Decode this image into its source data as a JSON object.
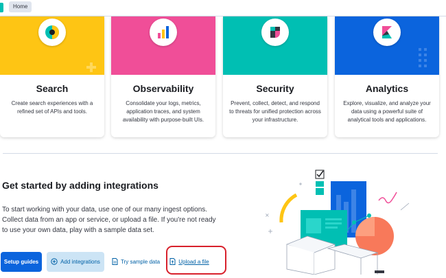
{
  "breadcrumb": {
    "home": "Home"
  },
  "cards": [
    {
      "id": "search",
      "title": "Search",
      "description": "Create search experiences with a refined set of APIs and tools.",
      "color": "#fec514",
      "icon": "search-icon"
    },
    {
      "id": "observability",
      "title": "Observability",
      "description": "Consolidate your logs, metrics, application traces, and system availability with purpose-built UIs.",
      "color": "#f04e98",
      "icon": "observability-icon"
    },
    {
      "id": "security",
      "title": "Security",
      "description": "Prevent, collect, detect, and respond to threats for unified protection across your infrastructure.",
      "color": "#00bfb3",
      "icon": "security-icon"
    },
    {
      "id": "analytics",
      "title": "Analytics",
      "description": "Explore, visualize, and analyze your data using a powerful suite of analytical tools and applications.",
      "color": "#0b64dd",
      "icon": "kibana-icon"
    }
  ],
  "get_started": {
    "title": "Get started by adding integrations",
    "text": "To start working with your data, use one of our many ingest options. Collect data from an app or service, or upload a file. If you're not ready to use your own data, play with a sample data set.",
    "buttons": {
      "setup_guides": "Setup guides",
      "add_integrations": "Add integrations",
      "try_sample_data": "Try sample data",
      "upload_file": "Upload a file"
    }
  },
  "colors": {
    "primary": "#0b64dd",
    "highlight": "#d8202b",
    "accent_teal": "#00bfb3",
    "accent_pink": "#f04e98",
    "accent_yellow": "#fec514"
  }
}
